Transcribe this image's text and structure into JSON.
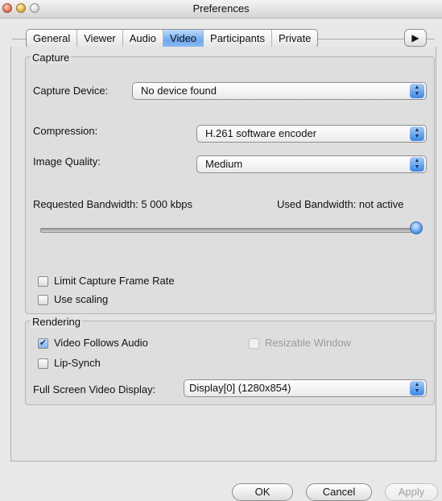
{
  "window": {
    "title": "Preferences"
  },
  "tabs": [
    {
      "label": "General"
    },
    {
      "label": "Viewer"
    },
    {
      "label": "Audio"
    },
    {
      "label": "Video",
      "active": true
    },
    {
      "label": "Participants"
    },
    {
      "label": "Private"
    }
  ],
  "tab_more_glyph": "▶",
  "capture": {
    "title": "Capture",
    "device_label": "Capture Device:",
    "device_value": "No device found",
    "compression_label": "Compression:",
    "compression_value": "H.261 software encoder",
    "quality_label": "Image Quality:",
    "quality_value": "Medium",
    "requested_bandwidth": "Requested Bandwidth: 5 000 kbps",
    "used_bandwidth": "Used Bandwidth: not active",
    "bandwidth_slider_fraction": 1.0,
    "limit_frame_rate_label": "Limit Capture Frame Rate",
    "limit_frame_rate_checked": false,
    "use_scaling_label": "Use scaling",
    "use_scaling_checked": false
  },
  "rendering": {
    "title": "Rendering",
    "video_follows_audio_label": "Video Follows Audio",
    "video_follows_audio_checked": true,
    "resizable_window_label": "Resizable Window",
    "resizable_window_enabled": false,
    "lip_synch_label": "Lip-Synch",
    "lip_synch_checked": false,
    "full_screen_label": "Full Screen Video Display:",
    "full_screen_value": "Display[0] (1280x854)"
  },
  "buttons": {
    "ok": "OK",
    "cancel": "Cancel",
    "apply": "Apply"
  },
  "colors": {
    "accent": "#5b9cec",
    "tab_active": "#8dbcf4"
  }
}
